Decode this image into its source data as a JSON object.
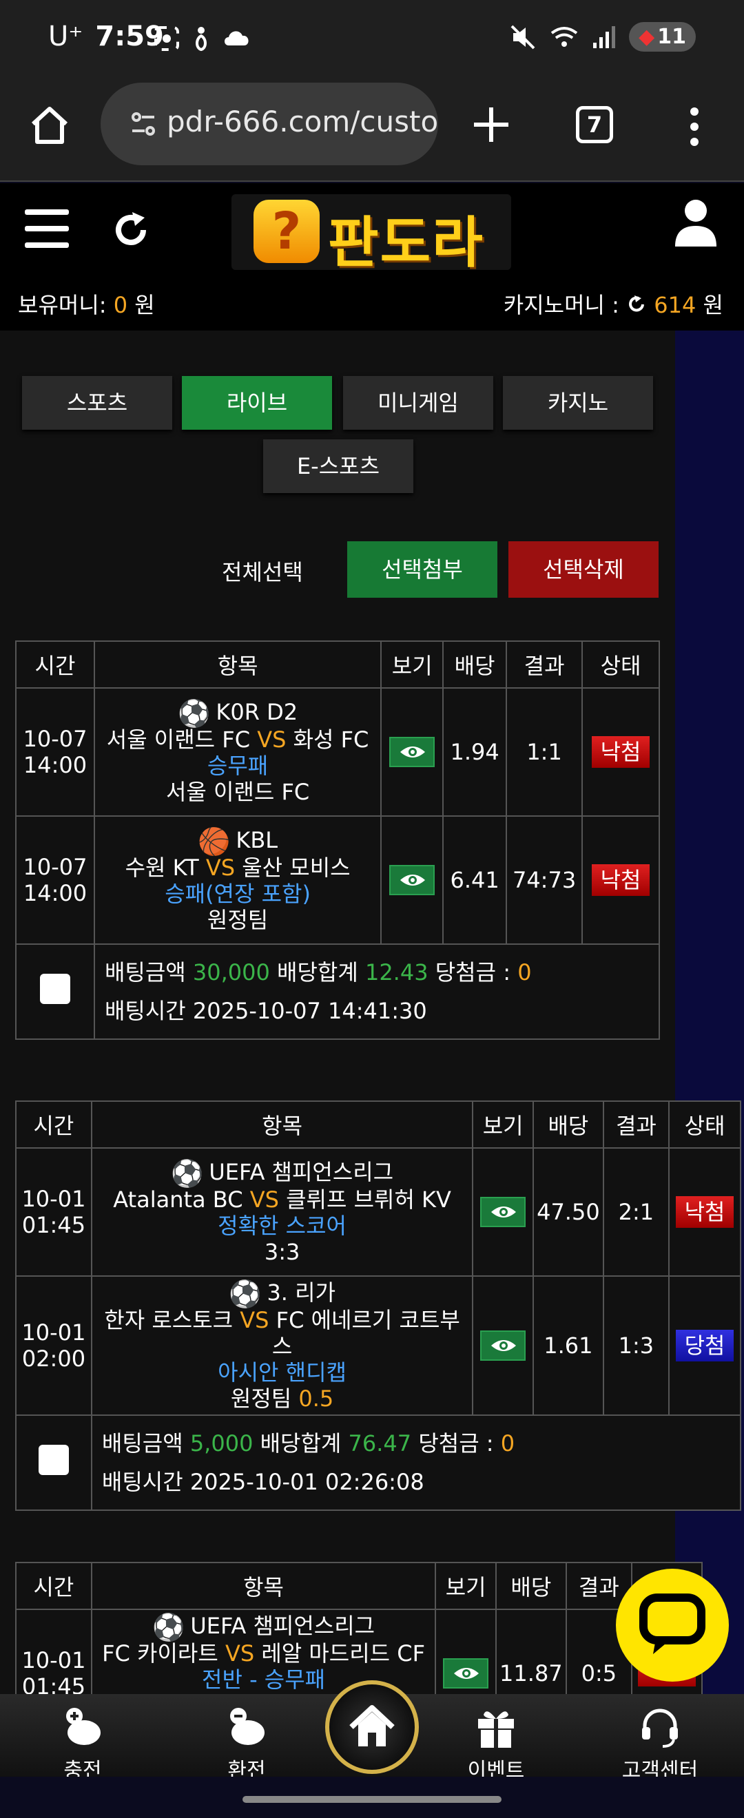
{
  "statusbar": {
    "carrier": "U⁺",
    "time": "7:59",
    "battery": "11"
  },
  "browser": {
    "url": "pdr-666.com/custo",
    "tab_count": "7"
  },
  "header": {
    "logo_badge": "?",
    "logo_text": "판도라",
    "holding_label": "보유머니:",
    "holding_value": "0",
    "holding_unit": "원",
    "casino_label": "카지노머니 :",
    "casino_value": "614",
    "casino_unit": "원"
  },
  "tabs": [
    "스포츠",
    "라이브",
    "미니게임",
    "카지노",
    "E-스포츠"
  ],
  "actions": {
    "select_all": "전체선택",
    "attach": "선택첨부",
    "delete": "선택삭제"
  },
  "table_headers": [
    "시간",
    "항목",
    "보기",
    "배당",
    "결과",
    "상태"
  ],
  "slips": [
    {
      "bets": [
        {
          "date": "10-07",
          "time": "14:00",
          "league": "K0R D2",
          "sport_icon": "soccer-ball",
          "home": "서울 이랜드 FC",
          "vs": "VS",
          "away": "화성 FC",
          "market": "승무패",
          "pick": "서울 이랜드 FC",
          "pick_extra": "",
          "odds": "1.94",
          "result": "1:1",
          "status": "낙첨"
        },
        {
          "date": "10-07",
          "time": "14:00",
          "league": "KBL",
          "sport_icon": "basketball",
          "home": "수원 KT",
          "vs": "VS",
          "away": "울산 모비스",
          "market": "승패(연장 포함)",
          "pick": "원정팀",
          "pick_extra": "",
          "odds": "6.41",
          "result": "74:73",
          "status": "낙첨"
        }
      ],
      "amount_label": "배팅금액",
      "amount": "30,000",
      "odds_label": "배당합계",
      "odds_total": "12.43",
      "win_label": "당첨금 :",
      "win": "0",
      "time_label": "배팅시간",
      "bet_time": "2025-10-07 14:41:30"
    },
    {
      "bets": [
        {
          "date": "10-01",
          "time": "01:45",
          "league": "UEFA 챔피언스리그",
          "sport_icon": "soccer-ball",
          "home": "Atalanta BC",
          "vs": "VS",
          "away": "클뤼프 브뤼허 KV",
          "market": "정확한 스코어",
          "pick": "3:3",
          "pick_extra": "",
          "odds": "47.50",
          "result": "2:1",
          "status": "낙첨"
        },
        {
          "date": "10-01",
          "time": "02:00",
          "league": "3. 리가",
          "sport_icon": "soccer-ball",
          "home": "한자 로스토크",
          "vs": "VS",
          "away": "FC 에네르기 코트부스",
          "market": "아시안 핸디캡",
          "pick": "원정팀",
          "pick_extra": "0.5",
          "odds": "1.61",
          "result": "1:3",
          "status": "당첨"
        }
      ],
      "amount_label": "배팅금액",
      "amount": "5,000",
      "odds_label": "배당합계",
      "odds_total": "76.47",
      "win_label": "당첨금 :",
      "win": "0",
      "time_label": "배팅시간",
      "bet_time": "2025-10-01 02:26:08"
    },
    {
      "bets": [
        {
          "date": "10-01",
          "time": "01:45",
          "league": "UEFA 챔피언스리그",
          "sport_icon": "soccer-ball",
          "home": "FC 카이라트",
          "vs": "VS",
          "away": "레알 마드리드 CF",
          "market": "전반 - 승무패",
          "pick": "",
          "pick_extra": "",
          "odds": "11.87",
          "result": "0:5",
          "status": ""
        }
      ]
    }
  ],
  "bottomnav": {
    "charge": "충전",
    "exchange": "환전",
    "event": "이벤트",
    "support": "고객센터"
  },
  "colors": {
    "active_tab": "#1a8a3a",
    "attach_btn": "#177a34",
    "delete_btn": "#9b1010",
    "odds_green": "#3bb54a",
    "vs_orange": "#f5a623",
    "market_blue": "#4aa3ff",
    "lose_badge": "#d01818",
    "win_badge": "#2020c8",
    "chat_yellow": "#ffe500"
  }
}
